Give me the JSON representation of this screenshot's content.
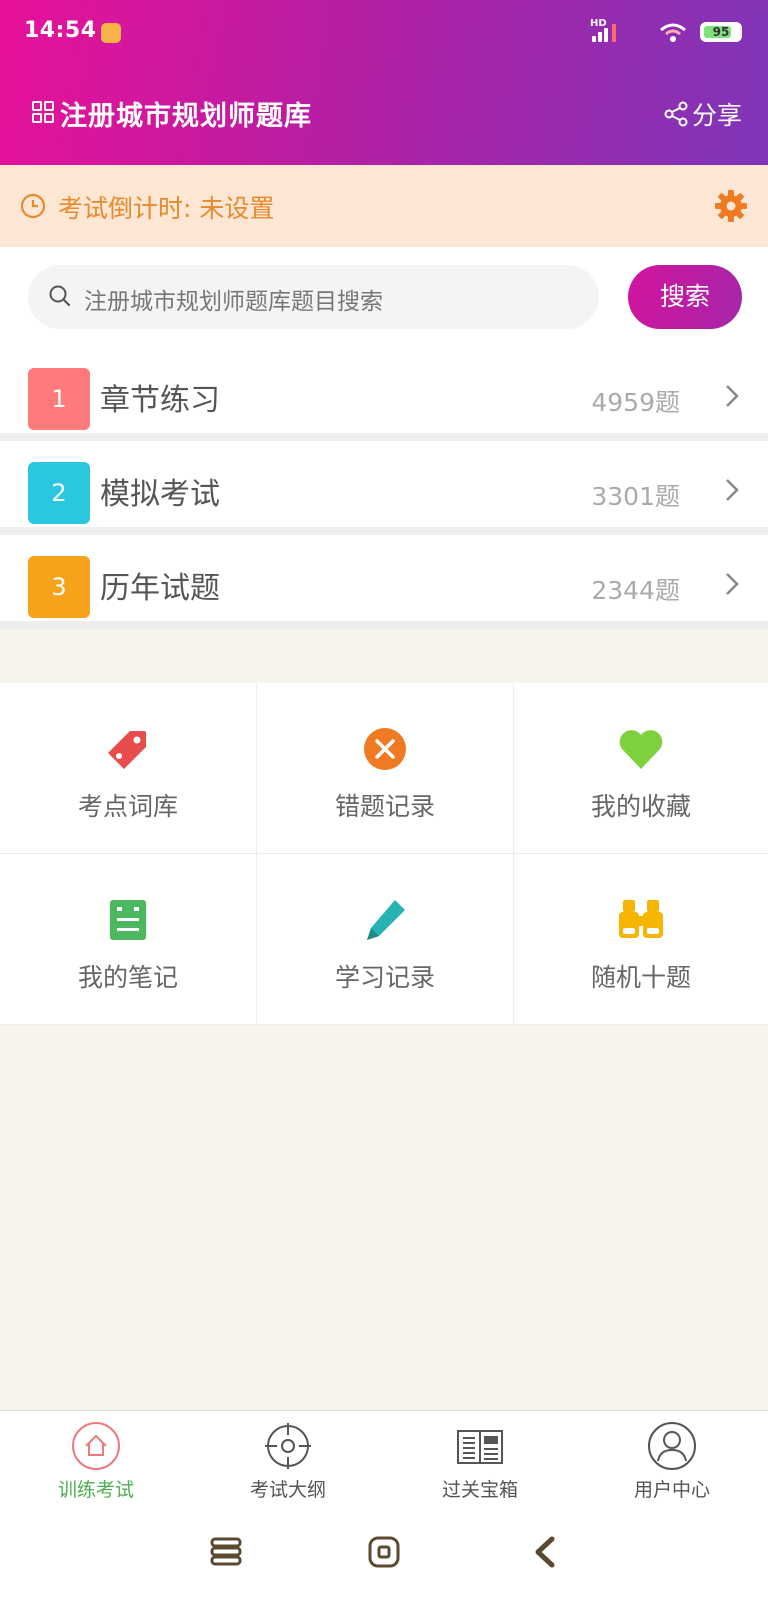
{
  "status_bar": {
    "time": "14:54",
    "battery": "95",
    "network": "HD"
  },
  "header": {
    "title": "注册城市规划师题库",
    "share_label": "分享"
  },
  "countdown": {
    "text": "考试倒计时: 未设置"
  },
  "search": {
    "placeholder": "注册城市规划师题库题目搜索",
    "button_label": "搜索"
  },
  "list": [
    {
      "number": "1",
      "label": "章节练习",
      "count": "4959题",
      "color": "#ff7a7a"
    },
    {
      "number": "2",
      "label": "模拟考试",
      "count": "3301题",
      "color": "#29c7e0"
    },
    {
      "number": "3",
      "label": "历年试题",
      "count": "2344题",
      "color": "#f7a21b"
    }
  ],
  "grid": [
    {
      "label": "考点词库",
      "icon": "tag-icon",
      "color": "#e84c4c"
    },
    {
      "label": "错题记录",
      "icon": "x-circle-icon",
      "color": "#f07a22"
    },
    {
      "label": "我的收藏",
      "icon": "heart-icon",
      "color": "#7ed03f"
    },
    {
      "label": "我的笔记",
      "icon": "note-icon",
      "color": "#4bb75e"
    },
    {
      "label": "学习记录",
      "icon": "pencil-icon",
      "color": "#27b3b3"
    },
    {
      "label": "随机十题",
      "icon": "binoculars-icon",
      "color": "#f5b500"
    }
  ],
  "bottom_nav": [
    {
      "label": "训练考试",
      "icon": "home-icon",
      "active": true
    },
    {
      "label": "考试大纲",
      "icon": "target-icon",
      "active": false
    },
    {
      "label": "过关宝箱",
      "icon": "news-icon",
      "active": false
    },
    {
      "label": "用户中心",
      "icon": "user-icon",
      "active": false
    }
  ],
  "colors": {
    "header_gradient_start": "#e8119a",
    "header_gradient_end": "#7e35b8",
    "countdown_bg": "#fde6d3",
    "countdown_text": "#e68a2e",
    "active_nav": "#4caf50"
  }
}
